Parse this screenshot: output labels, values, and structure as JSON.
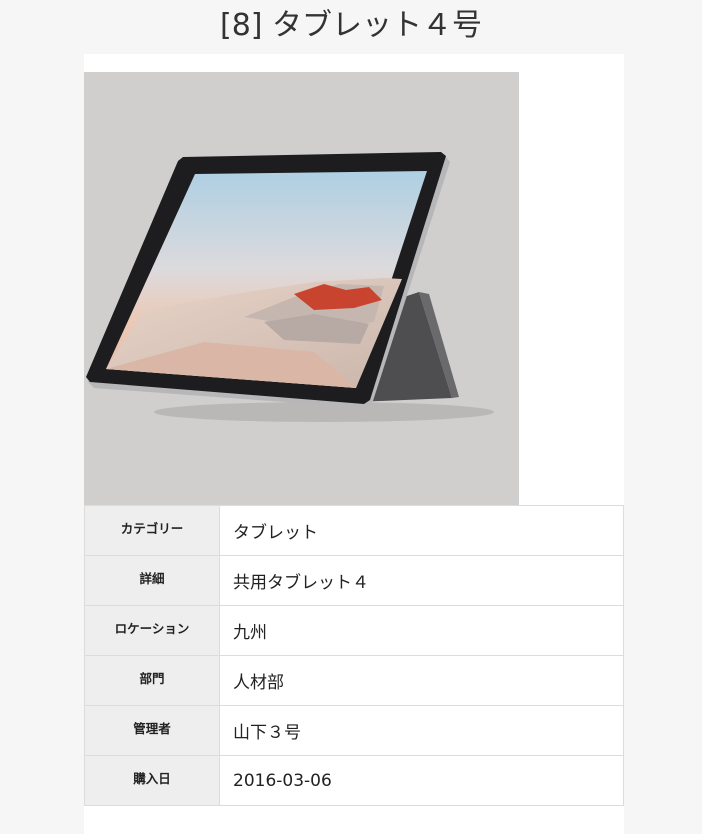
{
  "page": {
    "title": "[8] タブレット４号"
  },
  "product_image": {
    "kind": "tablet-photo",
    "background_color": "#d0cfcd"
  },
  "details": [
    {
      "label": "カテゴリー",
      "value": "タブレット"
    },
    {
      "label": "詳細",
      "value": "共用タブレット４"
    },
    {
      "label": "ロケーション",
      "value": "九州"
    },
    {
      "label": "部門",
      "value": "人材部"
    },
    {
      "label": "管理者",
      "value": "山下３号"
    },
    {
      "label": "購入日",
      "value": "2016-03-06"
    }
  ]
}
